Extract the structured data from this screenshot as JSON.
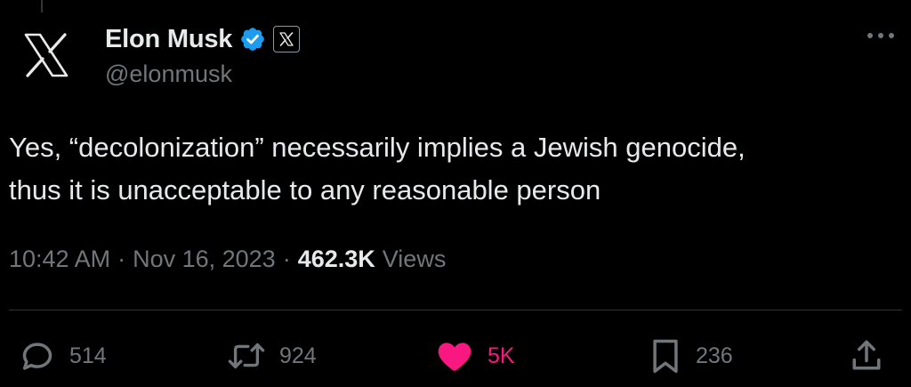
{
  "author": {
    "display_name": "Elon Musk",
    "handle": "@elonmusk",
    "verified": true,
    "affiliation": "X"
  },
  "tweet": {
    "text": "Yes, “decolonization” necessarily implies a Jewish genocide,\nthus it is unacceptable to any reasonable person",
    "time": "10:42 AM",
    "date": "Nov 16, 2023",
    "separator": "·",
    "views_count": "462.3K",
    "views_label": "Views"
  },
  "actions": {
    "replies": "514",
    "reposts": "924",
    "likes": "5K",
    "bookmarks": "236",
    "liked": true
  },
  "colors": {
    "background": "#000000",
    "text": "#e7e9ea",
    "secondary": "#71767b",
    "verified_blue": "#1d9bf0",
    "like_pink": "#f91880"
  },
  "icons": [
    "x-logo-icon",
    "verified-badge-icon",
    "x-affiliate-badge-icon",
    "more-options-icon",
    "reply-icon",
    "retweet-icon",
    "heart-icon",
    "bookmark-icon",
    "share-icon"
  ]
}
